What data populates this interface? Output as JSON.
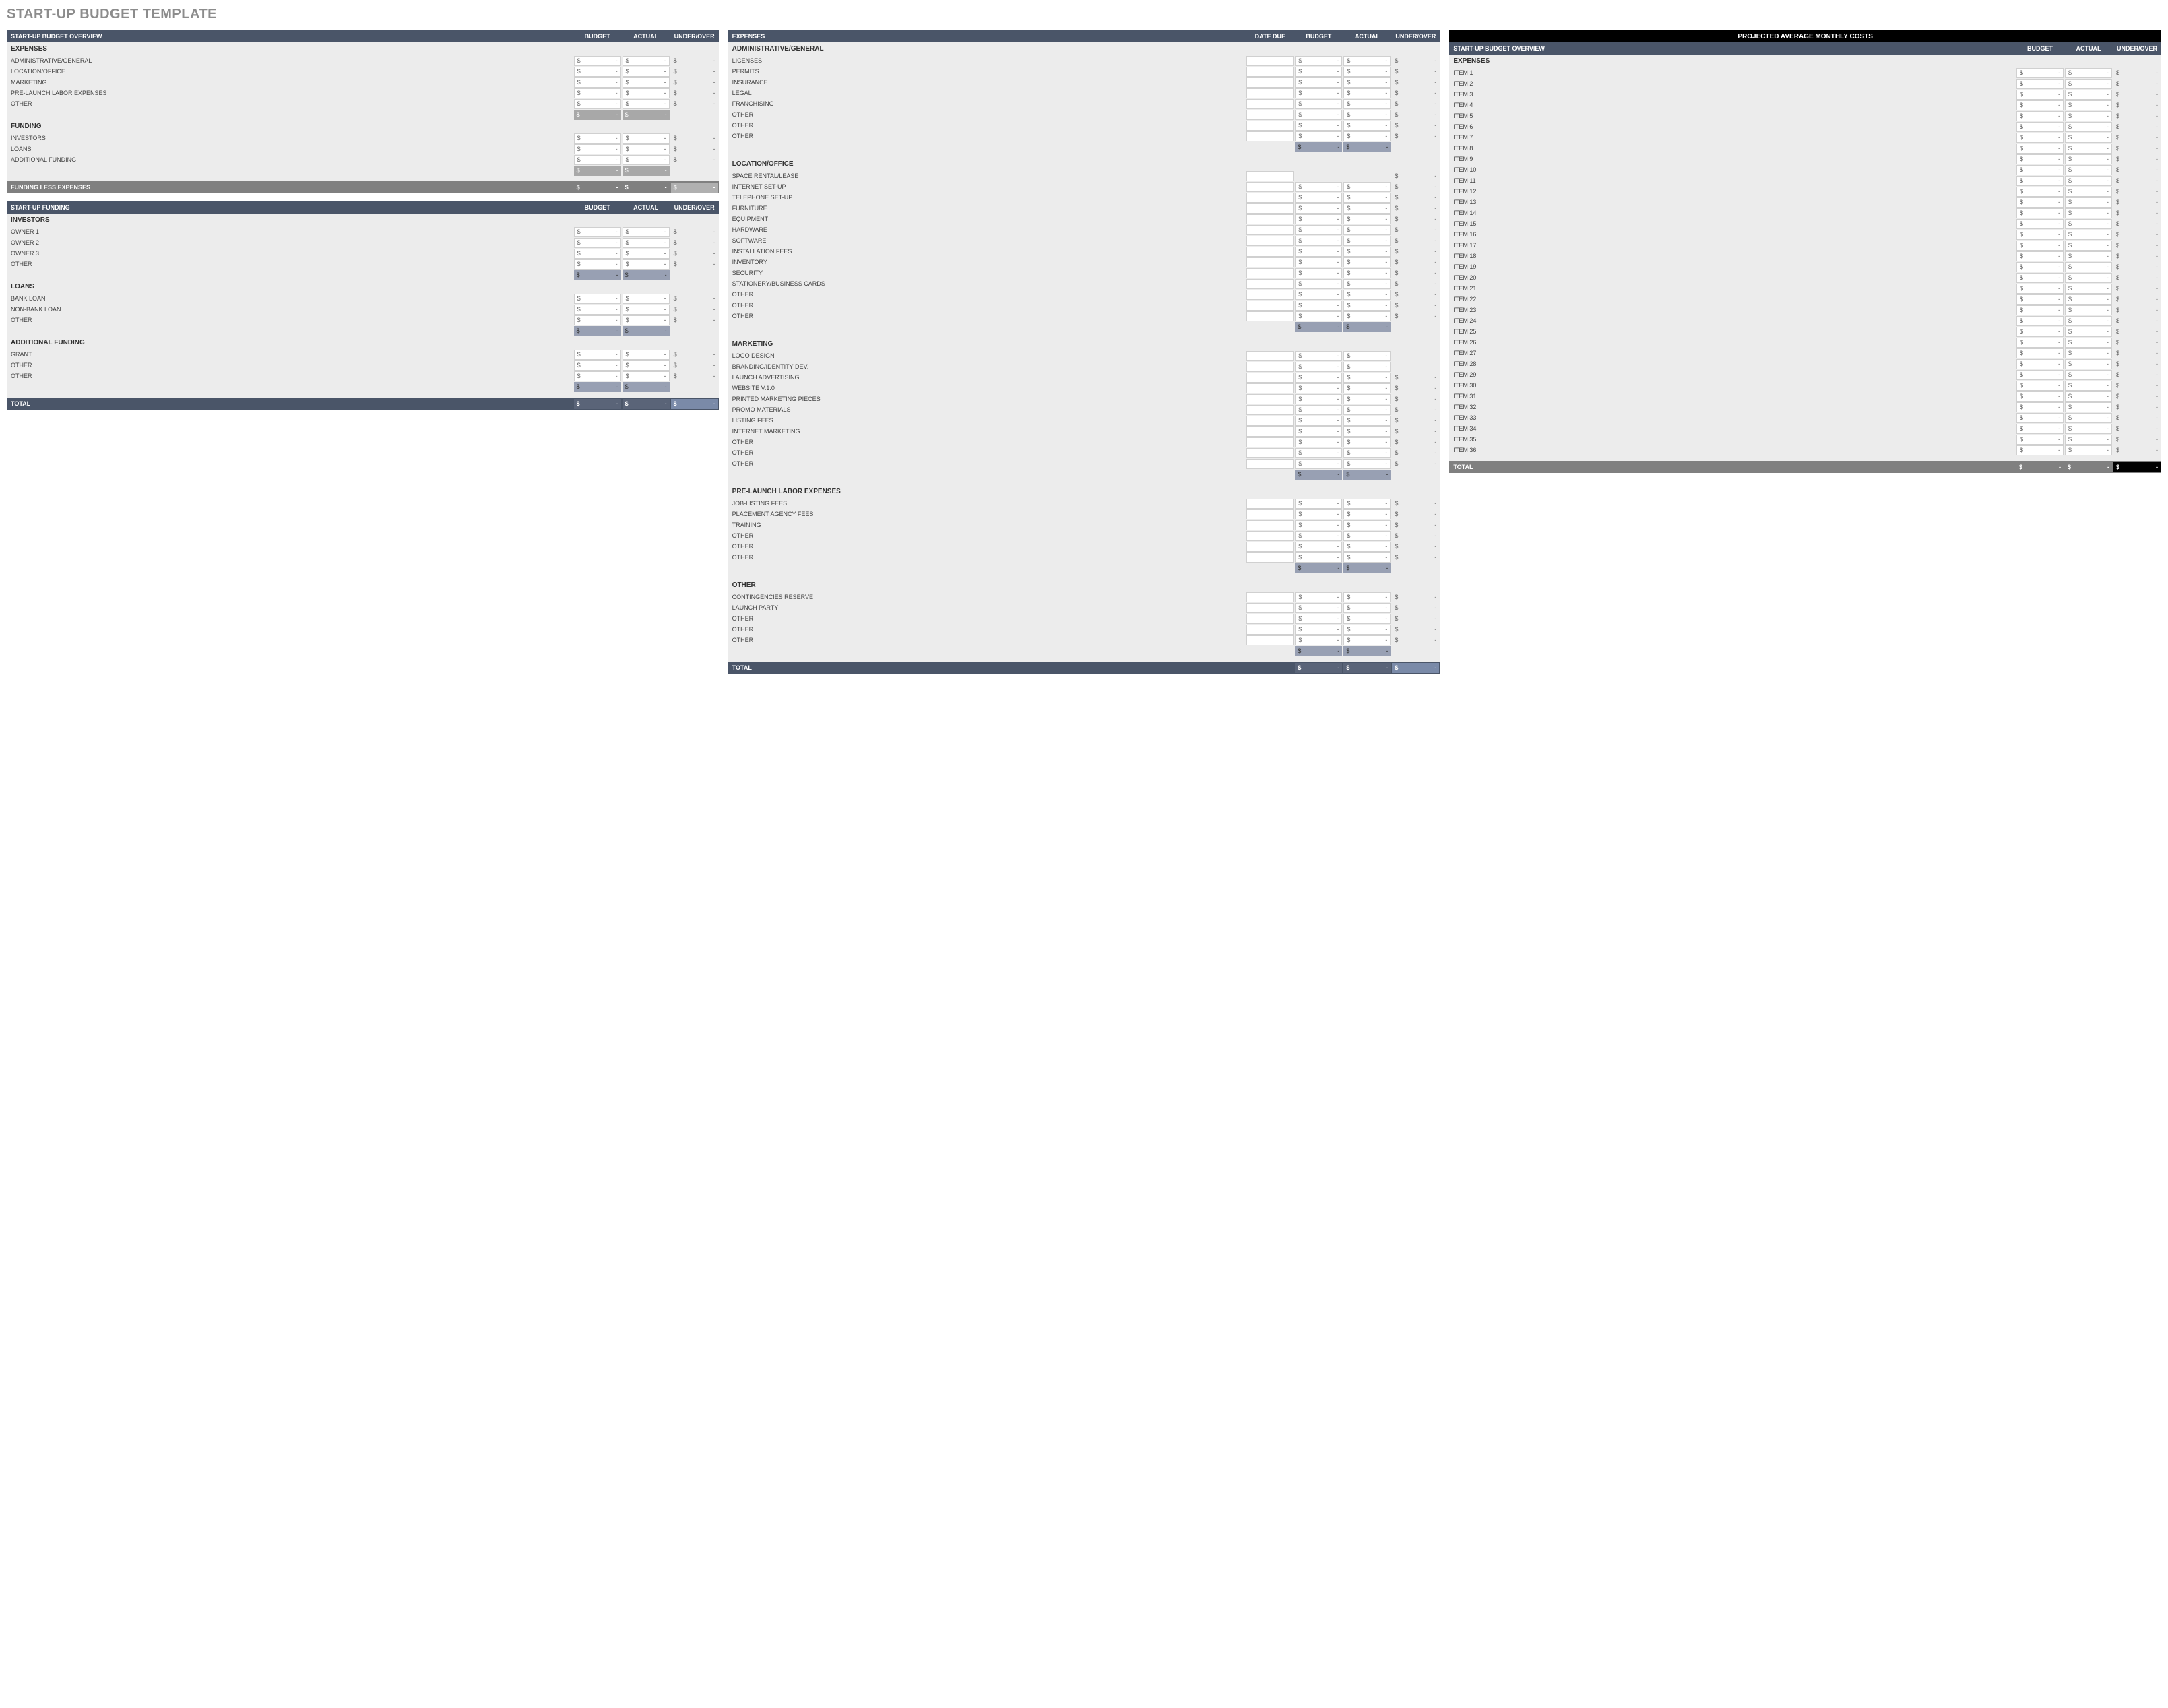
{
  "title": "START-UP BUDGET TEMPLATE",
  "headers": {
    "overview": "START-UP BUDGET OVERVIEW",
    "funding": "START-UP FUNDING",
    "expenses": "EXPENSES",
    "projected": "PROJECTED AVERAGE MONTHLY COSTS",
    "budget": "BUDGET",
    "actual": "ACTUAL",
    "under_over": "UNDER/OVER",
    "date_due": "DATE DUE",
    "total": "TOTAL",
    "funding_less": "FUNDING LESS EXPENSES"
  },
  "dollar": "$",
  "dash": "-",
  "overview": {
    "expenses_label": "EXPENSES",
    "expenses": [
      "ADMINISTRATIVE/GENERAL",
      "LOCATION/OFFICE",
      "MARKETING",
      "PRE-LAUNCH LABOR EXPENSES",
      "OTHER"
    ],
    "funding_label": "FUNDING",
    "funding": [
      "INVESTORS",
      "LOANS",
      "ADDITIONAL FUNDING"
    ]
  },
  "startup_funding": {
    "sections": [
      {
        "name": "INVESTORS",
        "items": [
          "OWNER 1",
          "OWNER 2",
          "OWNER 3",
          "OTHER"
        ]
      },
      {
        "name": "LOANS",
        "items": [
          "BANK LOAN",
          "NON-BANK LOAN",
          "OTHER"
        ]
      },
      {
        "name": "ADDITIONAL FUNDING",
        "items": [
          "GRANT",
          "OTHER",
          "OTHER"
        ]
      }
    ]
  },
  "expenses": {
    "sections": [
      {
        "name": "ADMINISTRATIVE/GENERAL",
        "items": [
          "LICENSES",
          "PERMITS",
          "INSURANCE",
          "LEGAL",
          "FRANCHISING",
          "OTHER",
          "OTHER",
          "OTHER"
        ]
      },
      {
        "name": "LOCATION/OFFICE",
        "items": [
          "SPACE RENTAL/LEASE",
          "INTERNET SET-UP",
          "TELEPHONE SET-UP",
          "FURNITURE",
          "EQUIPMENT",
          "HARDWARE",
          "SOFTWARE",
          "INSTALLATION FEES",
          "INVENTORY",
          "SECURITY",
          "STATIONERY/BUSINESS CARDS",
          "OTHER",
          "OTHER",
          "OTHER"
        ]
      },
      {
        "name": "MARKETING",
        "items": [
          "LOGO DESIGN",
          "BRANDING/IDENTITY DEV.",
          "LAUNCH ADVERTISING",
          "WEBSITE v.1.0",
          "PRINTED MARKETING PIECES",
          "PROMO MATERIALS",
          "LISTING FEES",
          "INTERNET MARKETING",
          "OTHER",
          "OTHER",
          "OTHER"
        ]
      },
      {
        "name": "PRE-LAUNCH LABOR EXPENSES",
        "items": [
          "JOB-LISTING FEES",
          "PLACEMENT AGENCY FEES",
          "TRAINING",
          "OTHER",
          "OTHER",
          "OTHER"
        ]
      },
      {
        "name": "OTHER",
        "items": [
          "CONTINGENCIES RESERVE",
          "LAUNCH PARTY",
          "OTHER",
          "OTHER",
          "OTHER"
        ]
      }
    ]
  },
  "special_rows": {
    "space_rental_no_budget_actual": true,
    "marketing_partial": {
      "LOGO DESIGN": "no_uo",
      "BRANDING/IDENTITY DEV.": "no_uo"
    }
  },
  "projected": {
    "expenses_label": "EXPENSES",
    "items": [
      "ITEM 1",
      "ITEM 2",
      "ITEM 3",
      "ITEM 4",
      "ITEM 5",
      "ITEM 6",
      "ITEM 7",
      "ITEM 8",
      "ITEM 9",
      "ITEM 10",
      "ITEM 11",
      "ITEM 12",
      "ITEM 13",
      "ITEM 14",
      "ITEM 15",
      "ITEM 16",
      "ITEM 17",
      "ITEM 18",
      "ITEM 19",
      "ITEM 20",
      "ITEM 21",
      "ITEM 22",
      "ITEM 23",
      "ITEM 24",
      "ITEM 25",
      "ITEM 26",
      "ITEM 27",
      "ITEM 28",
      "ITEM 29",
      "ITEM 30",
      "ITEM 31",
      "ITEM 32",
      "ITEM 33",
      "ITEM 34",
      "ITEM 35",
      "ITEM 36"
    ]
  }
}
